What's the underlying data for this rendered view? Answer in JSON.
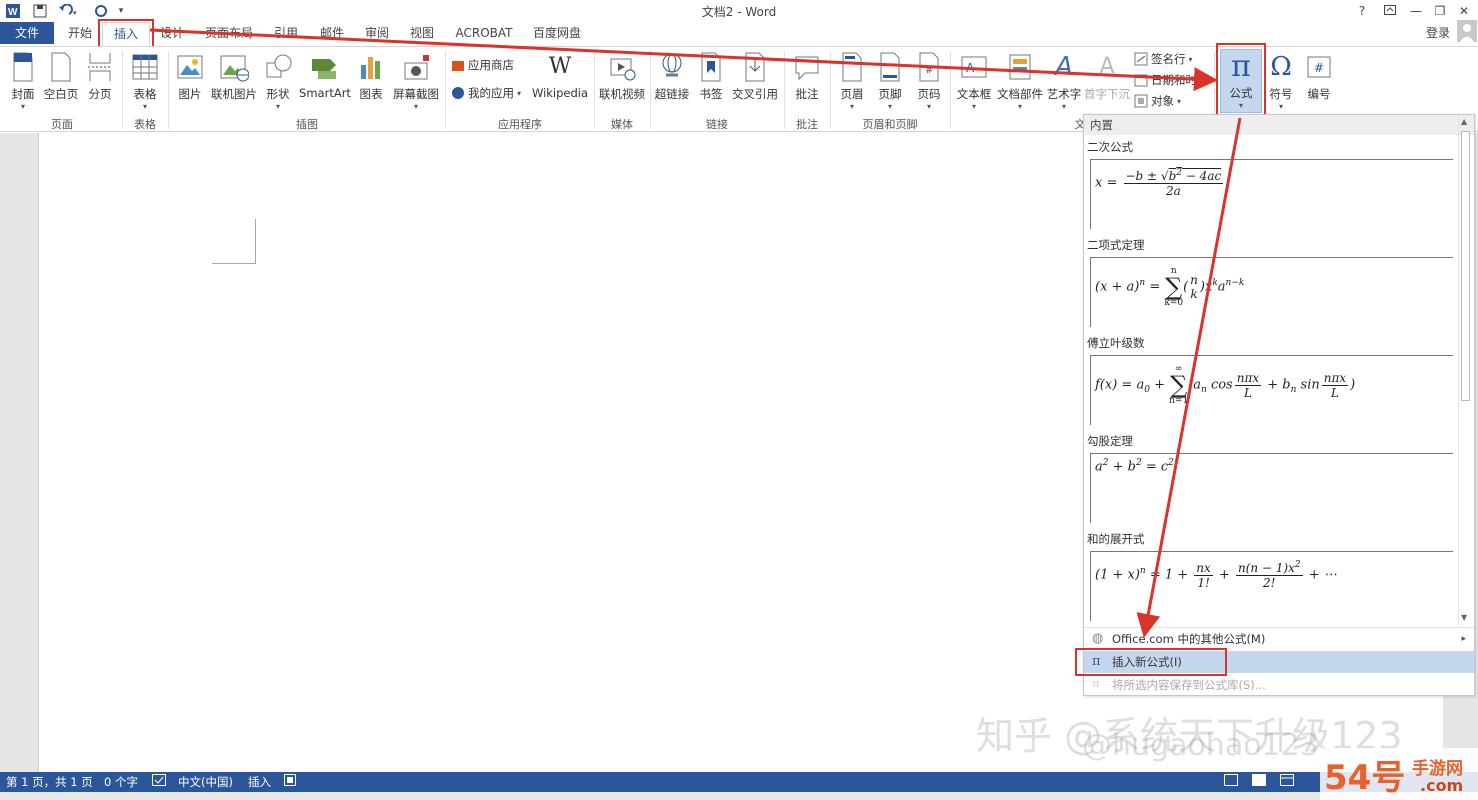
{
  "window": {
    "title": "文档2 - Word",
    "help": "?",
    "login": "登录"
  },
  "tabs": [
    "文件",
    "开始",
    "插入",
    "设计",
    "页面布局",
    "引用",
    "邮件",
    "审阅",
    "视图",
    "ACROBAT",
    "百度网盘"
  ],
  "ribbon": {
    "pages": {
      "cover": "封面",
      "blank": "空白页",
      "break": "分页",
      "group": "页面"
    },
    "table": {
      "table": "表格",
      "group": "表格"
    },
    "illustrations": {
      "picture": "图片",
      "online_picture": "联机图片",
      "shapes": "形状",
      "smartart": "SmartArt",
      "chart": "图表",
      "screenshot": "屏幕截图",
      "group": "插图"
    },
    "apps": {
      "store": "应用商店",
      "my_apps": "我的应用",
      "wikipedia": "Wikipedia",
      "group": "应用程序"
    },
    "media": {
      "online_video": "联机视频",
      "group": "媒体"
    },
    "links": {
      "hyperlink": "超链接",
      "bookmark": "书签",
      "cross_ref": "交叉引用",
      "group": "链接"
    },
    "comments": {
      "comment": "批注",
      "group": "批注"
    },
    "header_footer": {
      "header": "页眉",
      "footer": "页脚",
      "page_number": "页码",
      "group": "页眉和页脚"
    },
    "text": {
      "textbox": "文本框",
      "quick_parts": "文档部件",
      "wordart": "艺术字",
      "dropcap": "首字下沉",
      "signature": "签名行",
      "datetime": "日期和时间",
      "object": "对象",
      "group": "文"
    },
    "symbols": {
      "equation": "公式",
      "symbol": "符号",
      "number": "编号"
    }
  },
  "dropdown": {
    "header": "内置",
    "equations": [
      {
        "name": "二次公式"
      },
      {
        "name": "二项式定理"
      },
      {
        "name": "傅立叶级数"
      },
      {
        "name": "勾股定理"
      },
      {
        "name": "和的展开式"
      }
    ],
    "more": "Office.com 中的其他公式(M)",
    "insert_new": "插入新公式(I)",
    "save_selection": "将所选内容保存到公式库(S)..."
  },
  "status": {
    "page": "第 1 页，共 1 页",
    "words": "0 个字",
    "lang": "中文(中国)",
    "mode": "插入"
  },
  "watermark": {
    "zhihu": "知乎 @系统天下升级123",
    "hugao": "@hugaohao123",
    "site_big": "54号",
    "site_small": "手游网",
    "site_url": ".com"
  },
  "colors": {
    "accent": "#2b579a",
    "annotation": "#d9332a",
    "highlight": "#c5d7ee"
  }
}
